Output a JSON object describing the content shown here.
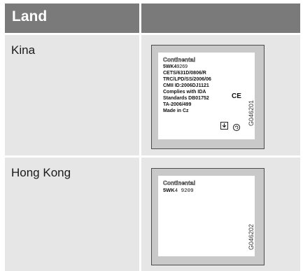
{
  "header": {
    "col1": "Land",
    "col2": ""
  },
  "rows": [
    {
      "country": "Kina",
      "label": {
        "brand": "Continental",
        "model_bold": "5WK4",
        "model_num": "9269",
        "lines": [
          "CETS/631D/0806/R",
          "TRC/LPD/SS/2006/06",
          "CMII ID:2006DJ1121",
          "Complies with IDA",
          "Standards DB01752",
          "TA-2006/499",
          "Made in Cz"
        ],
        "ce_mark": "CE",
        "code": "G046201"
      }
    },
    {
      "country": "Hong Kong",
      "label": {
        "brand": "Continental",
        "model_bold": "5WK",
        "model_num": "4 9209",
        "code": "G046202"
      }
    }
  ],
  "colors": {
    "header_bg": "#7a7a7a",
    "cell_bg": "#e6e6e6",
    "label_frame": "#c9c9c9"
  }
}
